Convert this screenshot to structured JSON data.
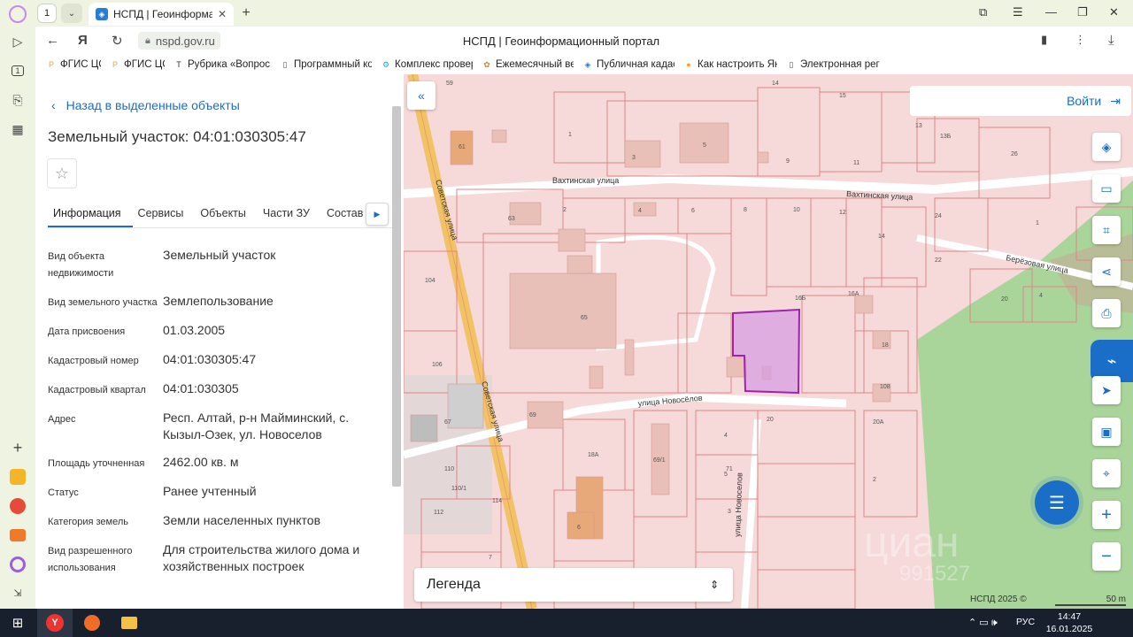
{
  "browser": {
    "tab_count": "1",
    "tab_title": "НСПД | Геоинформацион",
    "url": "nspd.gov.ru",
    "page_title": "НСПД | Геоинформационный портал",
    "bookmarks": [
      {
        "label": "ФГИС ЦС",
        "icon": "Р",
        "color": "#e8a24a"
      },
      {
        "label": "ФГИС ЦС",
        "icon": "Р",
        "color": "#e8a24a"
      },
      {
        "label": "Рубрика «Вопрос",
        "icon": "T",
        "color": "#333333"
      },
      {
        "label": "Программный ко",
        "icon": "▯",
        "color": "#555555"
      },
      {
        "label": "Комплекс провер",
        "icon": "⚙",
        "color": "#2b9bd1"
      },
      {
        "label": "Ежемесячный ве",
        "icon": "✿",
        "color": "#c48a3a"
      },
      {
        "label": "Публичная кадас",
        "icon": "◈",
        "color": "#2a7bd6"
      },
      {
        "label": "Как настроить Ян",
        "icon": "●",
        "color": "#f5a623"
      },
      {
        "label": "Электронная рег",
        "icon": "▯",
        "color": "#555555"
      }
    ]
  },
  "panel": {
    "back_label": "Назад в выделенные объекты",
    "title": "Земельный участок: 04:01:030305:47",
    "tabs": [
      "Информация",
      "Сервисы",
      "Объекты",
      "Части ЗУ",
      "Состав"
    ],
    "rows": [
      {
        "key": "Вид объекта недвижимости",
        "value": "Земельный участок"
      },
      {
        "key": "Вид земельного участка",
        "value": "Землепользование"
      },
      {
        "key": "Дата присвоения",
        "value": "01.03.2005"
      },
      {
        "key": "Кадастровый номер",
        "value": "04:01:030305:47"
      },
      {
        "key": "Кадастровый квартал",
        "value": "04:01:030305"
      },
      {
        "key": "Адрес",
        "value": "Респ. Алтай, р-н Майминский, с. Кызыл-Озек, ул. Новоселов"
      },
      {
        "key": "Площадь уточненная",
        "value": "2462.00 кв. м"
      },
      {
        "key": "Статус",
        "value": "Ранее учтенный"
      },
      {
        "key": "Категория земель",
        "value": "Земли населенных пунктов"
      },
      {
        "key": "Вид разрешенного использования",
        "value": "Для строительства жилого дома и хозяйственных построек"
      }
    ]
  },
  "map": {
    "login_label": "Войти",
    "legend_label": "Легенда",
    "copyright": "НСПД 2025 ©",
    "scale_label": "50 m",
    "streets": {
      "vakhtinskaya_1": "Вахтинская улица",
      "vakhtinskaya_2": "Вахтинская улица",
      "sovetskaya_1": "Советская улица",
      "sovetskaya_2": "Советская улица",
      "novoselov_1": "улица Новосёлов",
      "novoselov_2": "улица Новоселов",
      "berezovaya": "Берёзовая улица"
    },
    "watermark_1": "циан",
    "watermark_2": "991527",
    "house_numbers": [
      "59",
      "61",
      "1",
      "3",
      "5",
      "9",
      "11",
      "13",
      "13Б",
      "14",
      "15",
      "26",
      "24",
      "22",
      "63",
      "2",
      "4",
      "6",
      "8",
      "10",
      "12",
      "14",
      "1",
      "4",
      "104",
      "65",
      "16Б",
      "16А",
      "20",
      "18",
      "106",
      "67",
      "69",
      "18А",
      "108",
      "110",
      "110/1",
      "112",
      "114",
      "7",
      "69/1",
      "4",
      "5",
      "3",
      "71",
      "6",
      "20",
      "20А",
      "2"
    ],
    "selected_parcel_color": "#a020b0",
    "accent": "#1a6ec8"
  },
  "taskbar": {
    "lang": "РУС",
    "time": "14:47",
    "date": "16.01.2025"
  }
}
